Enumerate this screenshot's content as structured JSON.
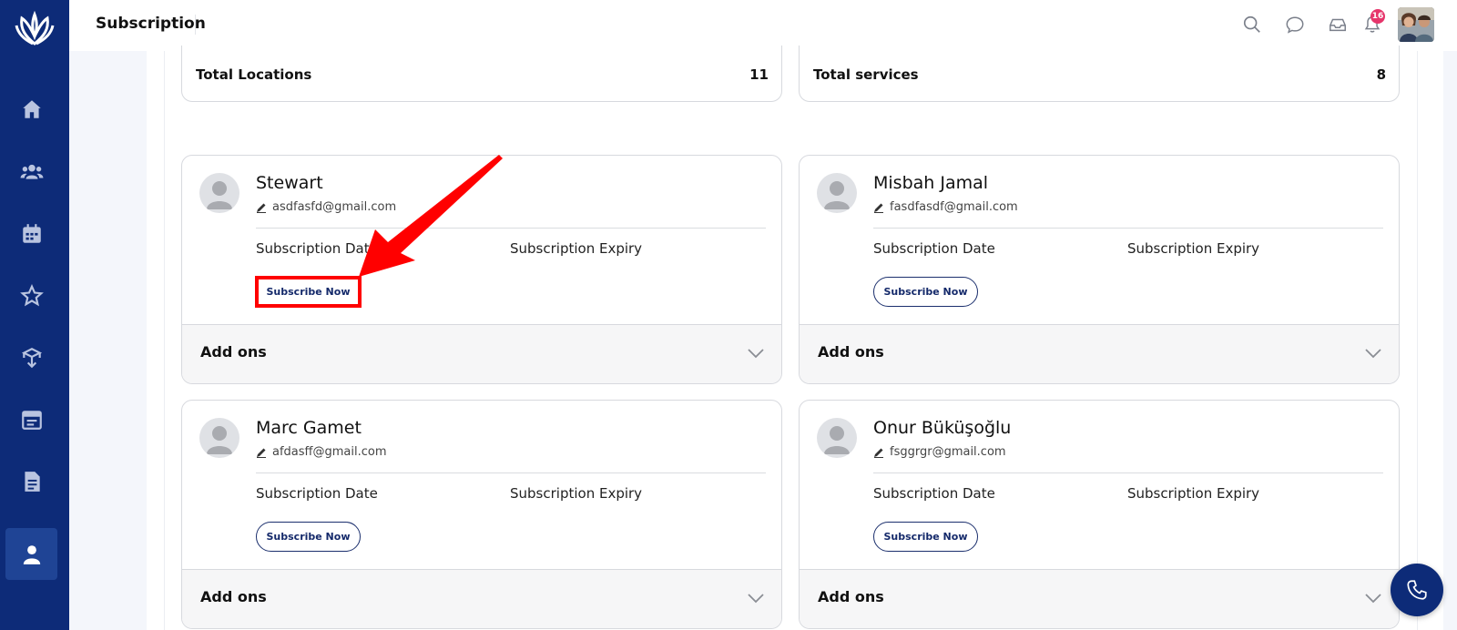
{
  "header": {
    "title": "Subscription",
    "notification_count": "16"
  },
  "stats": [
    {
      "label": "Total Locations",
      "value": "11"
    },
    {
      "label": "Total services",
      "value": "8"
    }
  ],
  "cards": [
    {
      "name": "Stewart",
      "email": "asdfasfd@gmail.com",
      "subscription_date_label": "Subscription Date",
      "subscription_expiry_label": "Subscription Expiry",
      "subscribe_label": "Subscribe Now",
      "addons_label": "Add ons"
    },
    {
      "name": "Misbah Jamal",
      "email": "fasdfasdf@gmail.com",
      "subscription_date_label": "Subscription Date",
      "subscription_expiry_label": "Subscription Expiry",
      "subscribe_label": "Subscribe Now",
      "addons_label": "Add ons"
    },
    {
      "name": "Marc Gamet",
      "email": "afdasff@gmail.com",
      "subscription_date_label": "Subscription Date",
      "subscription_expiry_label": "Subscription Expiry",
      "subscribe_label": "Subscribe Now",
      "addons_label": "Add ons"
    },
    {
      "name": "Onur Büküşoğlu",
      "email": "fsggrgr@gmail.com",
      "subscription_date_label": "Subscription Date",
      "subscription_expiry_label": "Subscription Expiry",
      "subscribe_label": "Subscribe Now",
      "addons_label": "Add ons"
    }
  ],
  "icons": {
    "sidebar": [
      "home-icon",
      "users-icon",
      "calendar-icon",
      "star-icon",
      "box-icon",
      "schedule-icon",
      "document-icon",
      "person-icon"
    ],
    "header": [
      "search-icon",
      "chat-icon",
      "inbox-icon",
      "bell-icon"
    ]
  },
  "colors": {
    "sidebar": "#0d2b78",
    "sidebar_active": "#1f4495",
    "badge": "#e6356b",
    "highlight": "#ff0000",
    "button_text": "#14296a"
  }
}
